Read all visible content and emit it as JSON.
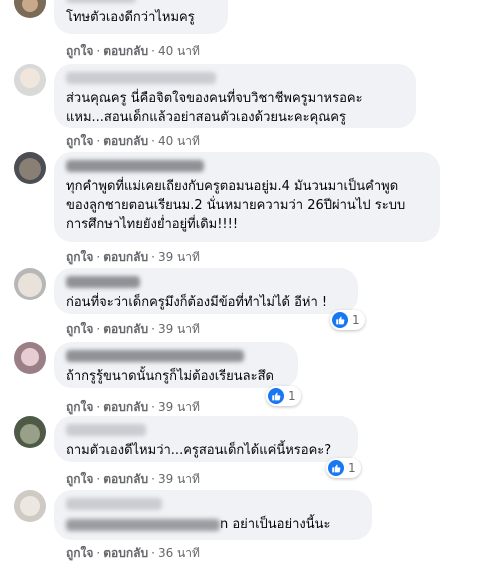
{
  "labels": {
    "like": "ถูกใจ",
    "reply": "ตอบกลับ",
    "dot": "·"
  },
  "comments": [
    {
      "text": "โทษตัวเองดีกว่าไหมครู",
      "time": "40 นาที"
    },
    {
      "text": "ส่วนคุณครู นี่คือจิตใจของคนที่จบวิชาชีพครูมาหรอคะ\nแหม...สอนเด็กแล้วอย่าสอนตัวเองด้วยนะคะคุณครู",
      "time": "40 นาที"
    },
    {
      "text": "ทุกคำพูดที่แม่เคยเถียงกับครูตอมนอยู่ม.4 มันวนมาเป็นคำพูด\nของลูกชายตอนเรียนม.2 นั่นหมายความว่า 26ปีผ่านไป ระบบ\nการศึกษาไทยยังย่ำอยู่ที่เดิม!!!!",
      "time": "39 นาที"
    },
    {
      "text": "ก่อนที่จะว่าเด็กครูมึงก็ต้องมีข้อที่ทำไม่ได้ อีห่า !",
      "time": "39 นาที",
      "reactions": "1"
    },
    {
      "text": "ถ้ากรูรู้ขนาดนั้นกรูก็ไม่ต้องเรียนละสึด",
      "time": "39 นาที",
      "reactions": "1"
    },
    {
      "text": "ถามตัวเองดีไหมว่า...ครูสอนเด็กได้แค่นี้หรอคะ?",
      "time": "39 นาที",
      "reactions": "1"
    },
    {
      "text": "n อย่าเป็นอย่างนี้นะ",
      "time": "36 นาที"
    }
  ]
}
